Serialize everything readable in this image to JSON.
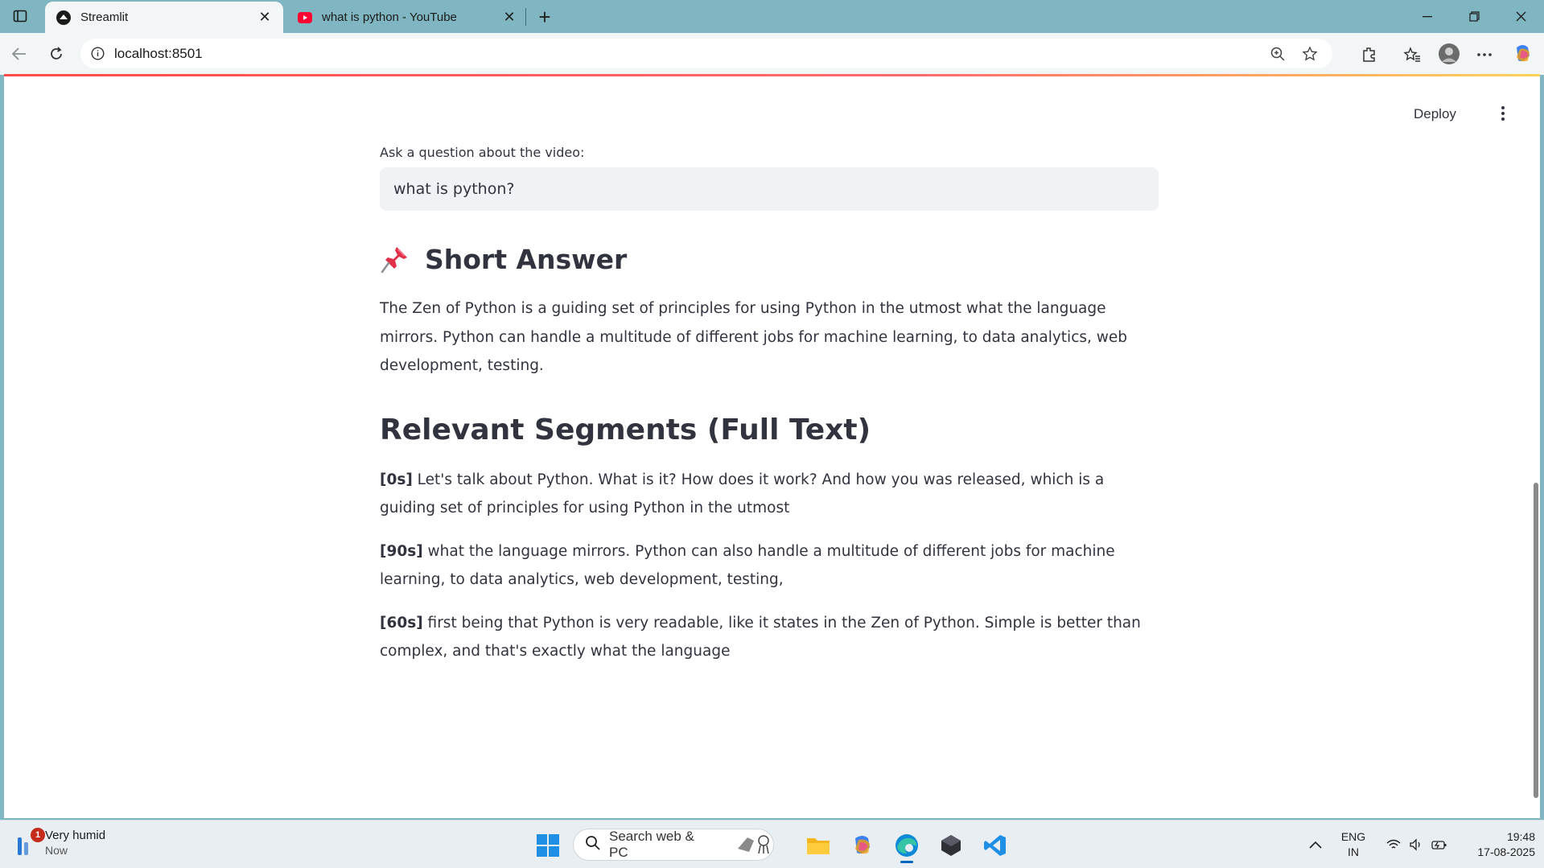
{
  "browser": {
    "tabs": [
      {
        "title": "Streamlit",
        "active": true
      },
      {
        "title": "what is python - YouTube",
        "active": false
      }
    ],
    "address": "localhost:8501"
  },
  "app": {
    "deploy_label": "Deploy",
    "input_label": "Ask a question about the video:",
    "input_value": "what is python?",
    "short_answer_heading": "Short Answer",
    "short_answer_text": "The Zen of Python is a guiding set of principles for using Python in the utmost what the language mirrors. Python can handle a multitude of different jobs for machine learning, to data analytics, web development, testing.",
    "segments_heading": "Relevant Segments (Full Text)",
    "segments": [
      {
        "time": "[0s]",
        "text": " Let's talk about Python. What is it? How does it work? And how you was released, which is a guiding set of principles for using Python in the utmost"
      },
      {
        "time": "[90s]",
        "text": " what the language mirrors. Python can also handle a multitude of different jobs for machine learning, to data analytics, web development, testing,"
      },
      {
        "time": "[60s]",
        "text": " first being that Python is very readable, like it states in the Zen of Python. Simple is better than complex, and that's exactly what the language"
      }
    ]
  },
  "taskbar": {
    "weather_title": "Very humid",
    "weather_sub": "Now",
    "weather_badge": "1",
    "search_placeholder": "Search web & PC",
    "lang_top": "ENG",
    "lang_bottom": "IN",
    "time": "19:48",
    "date": "17-08-2025"
  },
  "colors": {
    "tabstrip": "#7fb6c1",
    "streamlit_accent": "#ff4b4b",
    "text": "#31333f",
    "input_bg": "#f0f2f6"
  }
}
